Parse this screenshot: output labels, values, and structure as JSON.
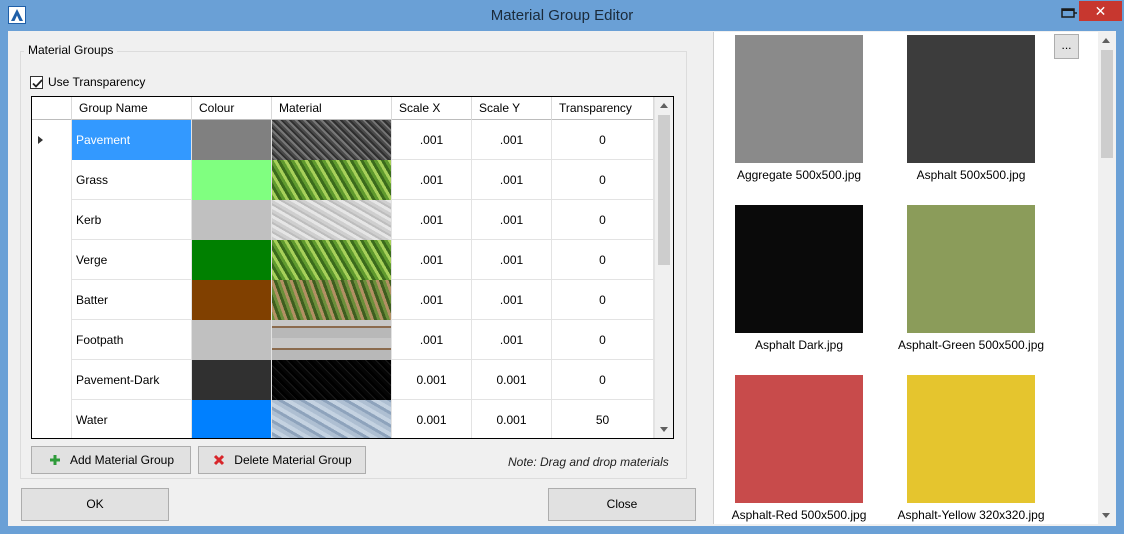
{
  "window": {
    "title": "Material Group Editor",
    "close_glyph": "✕"
  },
  "groupbox": {
    "label": "Material Groups",
    "use_transparency_label": "Use Transparency",
    "use_transparency_checked": true
  },
  "grid": {
    "columns": [
      "Group Name",
      "Colour",
      "Material",
      "Scale X",
      "Scale Y",
      "Transparency"
    ],
    "rows": [
      {
        "name": "Pavement",
        "colour": "#808080",
        "material": "aggregate",
        "scale_x": ".001",
        "scale_y": ".001",
        "transparency": "0",
        "selected": true
      },
      {
        "name": "Grass",
        "colour": "#80ff80",
        "material": "grass",
        "scale_x": ".001",
        "scale_y": ".001",
        "transparency": "0"
      },
      {
        "name": "Kerb",
        "colour": "#c0c0c0",
        "material": "concrete",
        "scale_x": ".001",
        "scale_y": ".001",
        "transparency": "0"
      },
      {
        "name": "Verge",
        "colour": "#008000",
        "material": "grass",
        "scale_x": ".001",
        "scale_y": ".001",
        "transparency": "0"
      },
      {
        "name": "Batter",
        "colour": "#804000",
        "material": "grass-dirt",
        "scale_x": ".001",
        "scale_y": ".001",
        "transparency": "0"
      },
      {
        "name": "Footpath",
        "colour": "#c0c0c0",
        "material": "paving",
        "scale_x": ".001",
        "scale_y": ".001",
        "transparency": "0"
      },
      {
        "name": "Pavement-Dark",
        "colour": "#303030",
        "material": "asphalt-dark",
        "scale_x": "0.001",
        "scale_y": "0.001",
        "transparency": "0"
      },
      {
        "name": "Water",
        "colour": "#0080ff",
        "material": "water",
        "scale_x": "0.001",
        "scale_y": "0.001",
        "transparency": "50"
      }
    ]
  },
  "buttons": {
    "add_group": "Add Material Group",
    "delete_group": "Delete Material Group",
    "ok": "OK",
    "close": "Close",
    "ellipsis": "..."
  },
  "note": "Note: Drag and drop materials",
  "materials": [
    {
      "caption": "Aggregate 500x500.jpg",
      "color": "#8a8a8a"
    },
    {
      "caption": "Asphalt 500x500.jpg",
      "color": "#3c3c3c"
    },
    {
      "caption": "Asphalt Dark.jpg",
      "color": "#0a0a0a"
    },
    {
      "caption": "Asphalt-Green 500x500.jpg",
      "color": "#8b9c5a"
    },
    {
      "caption": "Asphalt-Red 500x500.jpg",
      "color": "#c84b4b"
    },
    {
      "caption": "Asphalt-Yellow 320x320.jpg",
      "color": "#e5c52e"
    }
  ]
}
